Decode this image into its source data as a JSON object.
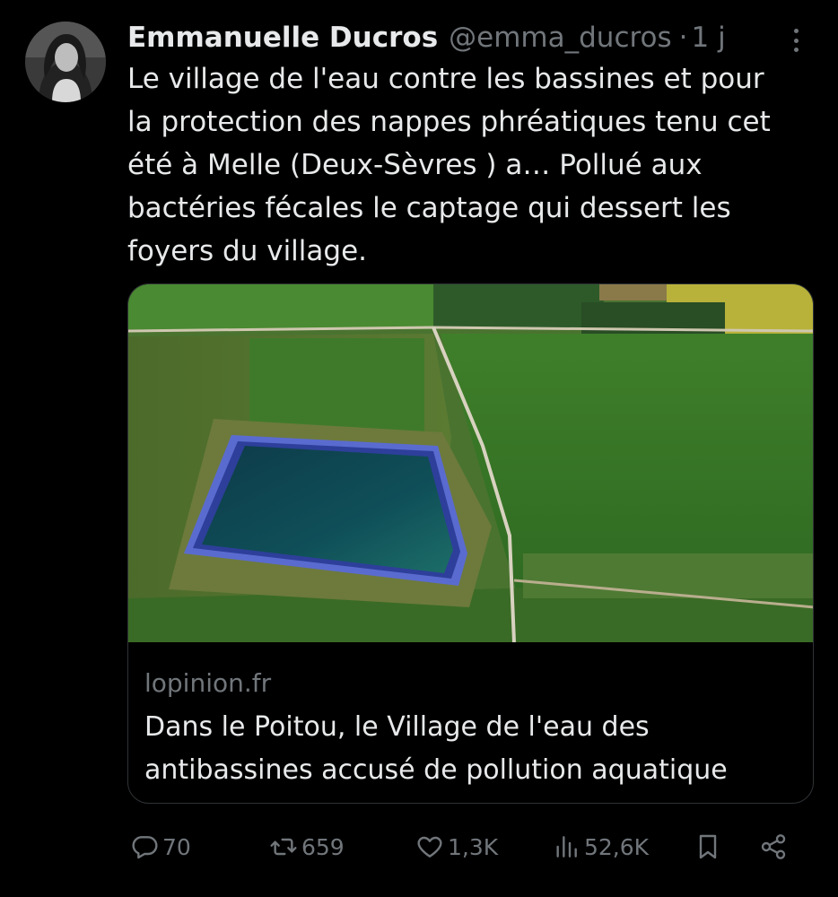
{
  "author": {
    "display_name": "Emmanuelle Ducros",
    "handle": "@emma_ducros",
    "separator": "·",
    "time": "1 j",
    "avatar_icon": "user-avatar"
  },
  "tweet": {
    "text": "Le village de l'eau contre les bassines et pour\nla protection des nappes phréatiques tenu cet\nété à Melle (Deux-Sèvres ) a… Pollué aux\nbactéries fécales le captage qui dessert les\nfoyers du village."
  },
  "card": {
    "domain": "lopinion.fr",
    "title": "Dans le Poitou, le Village de l'eau des antibassines accusé de pollution aquatique",
    "image_icon": "aerial-reservoir-photo"
  },
  "actions": {
    "replies": "70",
    "retweets": "659",
    "likes": "1,3K",
    "views": "52,6K"
  },
  "colors": {
    "background": "#000000",
    "text": "#e7e9ea",
    "muted": "#71767b",
    "border": "#2f3336"
  }
}
